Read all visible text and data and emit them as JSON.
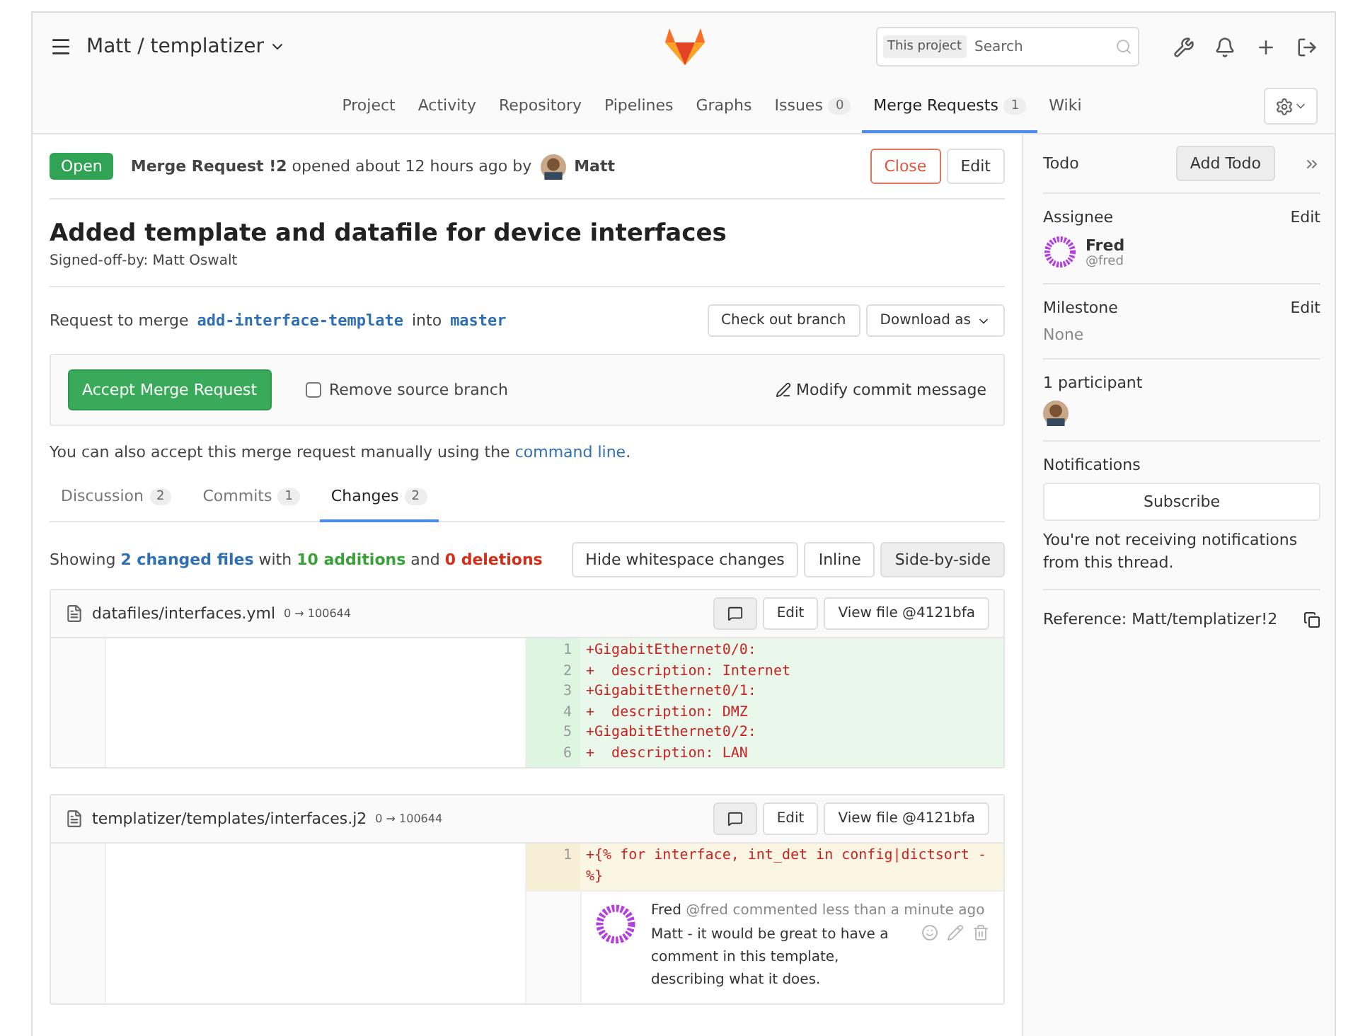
{
  "header": {
    "project": "Matt / templatizer",
    "search": {
      "scope": "This project",
      "placeholder": "Search"
    }
  },
  "nav": [
    {
      "label": "Project",
      "selected": false
    },
    {
      "label": "Activity",
      "selected": false
    },
    {
      "label": "Repository",
      "selected": false
    },
    {
      "label": "Pipelines",
      "selected": false
    },
    {
      "label": "Graphs",
      "selected": false
    },
    {
      "label": "Issues",
      "count": "0",
      "selected": false
    },
    {
      "label": "Merge Requests",
      "count": "1",
      "selected": true
    },
    {
      "label": "Wiki",
      "selected": false
    }
  ],
  "mr": {
    "status": "Open",
    "summary": "**Merge Request !2** opened about 12 hours ago by",
    "author": "Matt",
    "close": "Close",
    "edit": "Edit",
    "title": "Added template and datafile for device interfaces",
    "description": "Signed-off-by: Matt Oswalt",
    "merge_prefix": "Request to merge",
    "source": "add-interface-template",
    "into": "into",
    "target": "master",
    "checkout": "Check out branch",
    "download": "Download as",
    "accept": "Accept Merge Request",
    "remove_source": {
      "label": "Remove source branch",
      "checked": false
    },
    "modify": "Modify commit message",
    "manual_text": "You can also accept this merge request manually using the",
    "manual_link": "command line",
    "manual_end": "."
  },
  "tabs": [
    {
      "label": "Discussion",
      "count": "2",
      "selected": false
    },
    {
      "label": "Commits",
      "count": "1",
      "selected": false
    },
    {
      "label": "Changes",
      "count": "2",
      "selected": true
    }
  ],
  "stats": "Showing **2 changed files** with **10 additions** and **0 deletions**",
  "view_buttons": [
    {
      "label": "Hide whitespace changes",
      "selected": false
    },
    {
      "label": "Inline",
      "selected": false
    },
    {
      "label": "Side-by-side",
      "selected": true
    }
  ],
  "files": [
    {
      "path": "datafiles/interfaces.yml",
      "mode": "0 → 100644",
      "edit": "Edit",
      "view": "View file @4121bfa",
      "kind": "added",
      "lines": [
        {
          "n": "1",
          "code": "+GigabitEthernet0/0:"
        },
        {
          "n": "2",
          "code": "+  description: Internet"
        },
        {
          "n": "3",
          "code": "+GigabitEthernet0/1:"
        },
        {
          "n": "4",
          "code": "+  description: DMZ"
        },
        {
          "n": "5",
          "code": "+GigabitEthernet0/2:"
        },
        {
          "n": "6",
          "code": "+  description: LAN"
        }
      ]
    },
    {
      "path": "templatizer/templates/interfaces.j2",
      "mode": "0 → 100644",
      "edit": "Edit",
      "view": "View file @4121bfa",
      "kind": "commented",
      "lines": [
        {
          "n": "1",
          "code": "+{% for interface, int_det in config|dictsort -%}"
        }
      ],
      "comment": {
        "author": "Fred",
        "handle": "@fred",
        "when": "commented less than a minute ago",
        "body": "Matt - it would be great to have a comment in this template, describing what it does."
      }
    }
  ],
  "sidebar": {
    "todo": "Todo",
    "add_todo": "Add Todo",
    "assignee_label": "Assignee",
    "assignee_edit": "Edit",
    "assignee_name": "Fred",
    "assignee_handle": "@fred",
    "milestone_label": "Milestone",
    "milestone_edit": "Edit",
    "milestone_value": "None",
    "participants": "1 participant",
    "notifications": "Notifications",
    "subscribe": "Subscribe",
    "notice": "You're not receiving notifications from this thread.",
    "reference": "Reference: Matt/templatizer!2"
  }
}
